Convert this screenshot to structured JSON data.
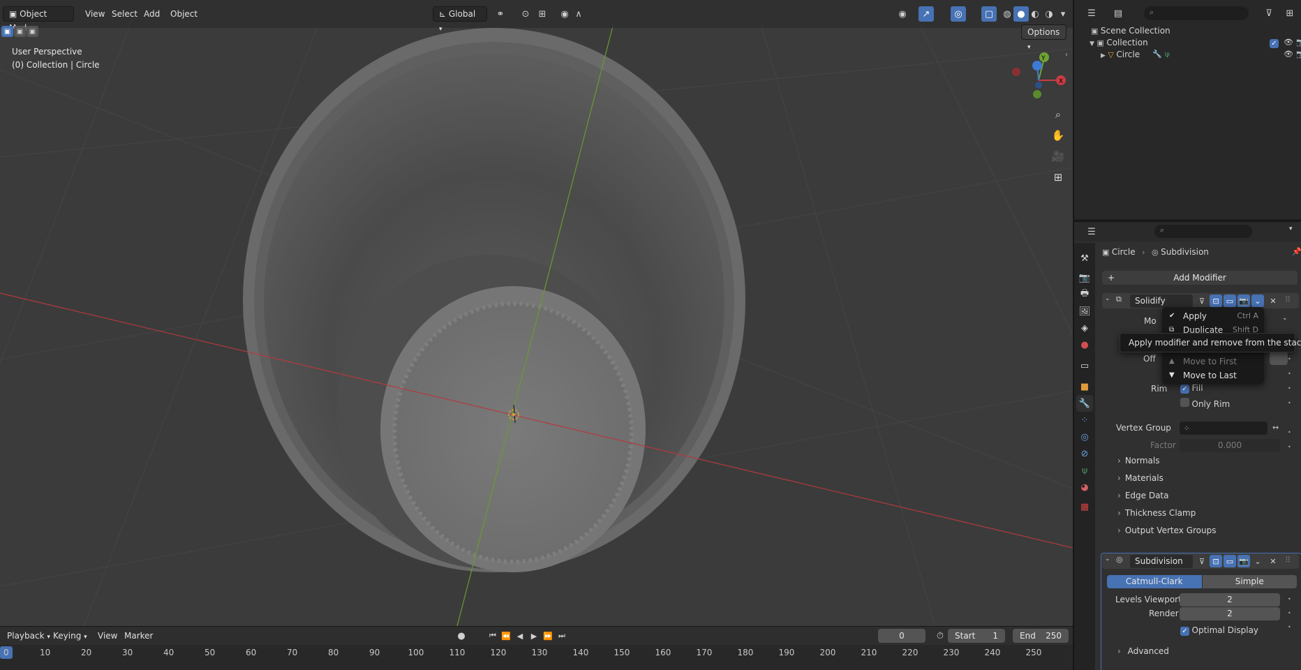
{
  "header": {
    "mode": "Object Mode",
    "menus": [
      "View",
      "Select",
      "Add",
      "Object"
    ],
    "transform_orientation": "Global",
    "options_label": "Options"
  },
  "viewport": {
    "perspective_label": "User Perspective",
    "collection_label": "(0) Collection | Circle",
    "gizmo_axes": [
      "Y",
      "X"
    ]
  },
  "outliner": {
    "scene_collection": "Scene Collection",
    "collection": "Collection",
    "object": "Circle"
  },
  "properties": {
    "breadcrumb_object": "Circle",
    "breadcrumb_modifier": "Subdivision",
    "add_modifier": "Add Modifier",
    "solidify": {
      "name": "Solidify",
      "mode_label_partial": "Mo",
      "offset_label_partial": "Off",
      "rim_label": "Rim",
      "fill_label": "Fill",
      "fill_checked": true,
      "only_rim_label": "Only Rim",
      "only_rim_checked": false,
      "vertex_group_label": "Vertex Group",
      "factor_label": "Factor",
      "factor_value": "0.000",
      "panels": [
        "Normals",
        "Materials",
        "Edge Data",
        "Thickness Clamp",
        "Output Vertex Groups"
      ]
    },
    "subdivision": {
      "name": "Subdivision",
      "type_options": [
        "Catmull-Clark",
        "Simple"
      ],
      "selected_type": "Catmull-Clark",
      "levels_viewport_label": "Levels Viewport",
      "levels_viewport_value": "2",
      "render_label": "Render",
      "render_value": "2",
      "optimal_display_label": "Optimal Display",
      "optimal_display_checked": true,
      "advanced_label": "Advanced"
    }
  },
  "context_menu": {
    "items": [
      {
        "label": "Apply",
        "shortcut": "Ctrl A",
        "icon": "check-icon"
      },
      {
        "label": "Duplicate",
        "shortcut": "Shift D",
        "icon": "duplicate-icon"
      },
      {
        "label": "Move to First",
        "shortcut": "",
        "icon": "triangle-up-icon"
      },
      {
        "label": "Move to Last",
        "shortcut": "",
        "icon": "triangle-down-icon"
      }
    ],
    "tooltip": "Apply modifier and remove from the stack."
  },
  "timeline": {
    "menus": [
      "Playback",
      "Keying",
      "View",
      "Marker"
    ],
    "current_frame": "0",
    "start_label": "Start",
    "start_value": "1",
    "end_label": "End",
    "end_value": "250",
    "ruler_ticks": [
      "0",
      "10",
      "20",
      "30",
      "40",
      "50",
      "60",
      "70",
      "80",
      "90",
      "100",
      "110",
      "120",
      "130",
      "140",
      "150",
      "160",
      "170",
      "180",
      "190",
      "200",
      "210",
      "220",
      "230",
      "240",
      "250"
    ]
  },
  "colors": {
    "accent": "#4772b3",
    "x_axis": "#c83c44",
    "y_axis": "#6ea234",
    "z_axis": "#3d7ad4"
  }
}
